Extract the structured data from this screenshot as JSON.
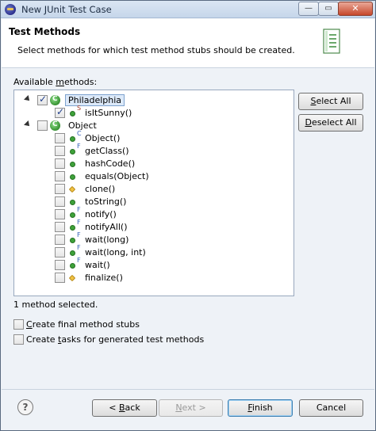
{
  "window": {
    "title": "New JUnit Test Case",
    "buttons": {
      "minimize": "—",
      "maximize": "▭",
      "close": "✕"
    }
  },
  "header": {
    "title": "Test Methods",
    "description": "Select methods for which test method stubs should be created."
  },
  "methods_label": {
    "pre": "Available ",
    "mnemonic": "m",
    "post": "ethods:"
  },
  "tree": {
    "rows": [
      {
        "label": "Philadelphia",
        "checked": true,
        "kind": "class",
        "selected": true
      },
      {
        "label": "isItSunny()",
        "checked": true,
        "kind": "method",
        "modifier": "S"
      },
      {
        "label": "Object",
        "checked": false,
        "kind": "class"
      },
      {
        "label": "Object()",
        "checked": false,
        "kind": "method",
        "modifier": "C"
      },
      {
        "label": "getClass()",
        "checked": false,
        "kind": "method",
        "modifier": "F"
      },
      {
        "label": "hashCode()",
        "checked": false,
        "kind": "method",
        "modifier": ""
      },
      {
        "label": "equals(Object)",
        "checked": false,
        "kind": "method",
        "modifier": ""
      },
      {
        "label": "clone()",
        "checked": false,
        "kind": "protected-method",
        "modifier": ""
      },
      {
        "label": "toString()",
        "checked": false,
        "kind": "method",
        "modifier": ""
      },
      {
        "label": "notify()",
        "checked": false,
        "kind": "method",
        "modifier": "F"
      },
      {
        "label": "notifyAll()",
        "checked": false,
        "kind": "method",
        "modifier": "F"
      },
      {
        "label": "wait(long)",
        "checked": false,
        "kind": "method",
        "modifier": "F"
      },
      {
        "label": "wait(long, int)",
        "checked": false,
        "kind": "method",
        "modifier": "F"
      },
      {
        "label": "wait()",
        "checked": false,
        "kind": "method",
        "modifier": "F"
      },
      {
        "label": "finalize()",
        "checked": false,
        "kind": "protected-method",
        "modifier": ""
      }
    ]
  },
  "side_buttons": {
    "select_all": {
      "mnemonic": "S",
      "rest": "elect All"
    },
    "deselect_all": {
      "mnemonic": "D",
      "rest": "eselect All"
    }
  },
  "status": "1 method selected.",
  "options": {
    "final_stubs": {
      "pre": "",
      "mnemonic": "C",
      "post": "reate final method stubs",
      "checked": false
    },
    "tasks": {
      "pre": "Create ",
      "mnemonic": "t",
      "post": "asks for generated test methods",
      "checked": false
    }
  },
  "footer": {
    "help": "?",
    "back": {
      "pre": "< ",
      "mnemonic": "B",
      "post": "ack",
      "enabled": true
    },
    "next": {
      "mnemonic": "N",
      "post": "ext >",
      "enabled": false
    },
    "finish": {
      "mnemonic": "F",
      "post": "inish",
      "enabled": true
    },
    "cancel": "Cancel"
  }
}
